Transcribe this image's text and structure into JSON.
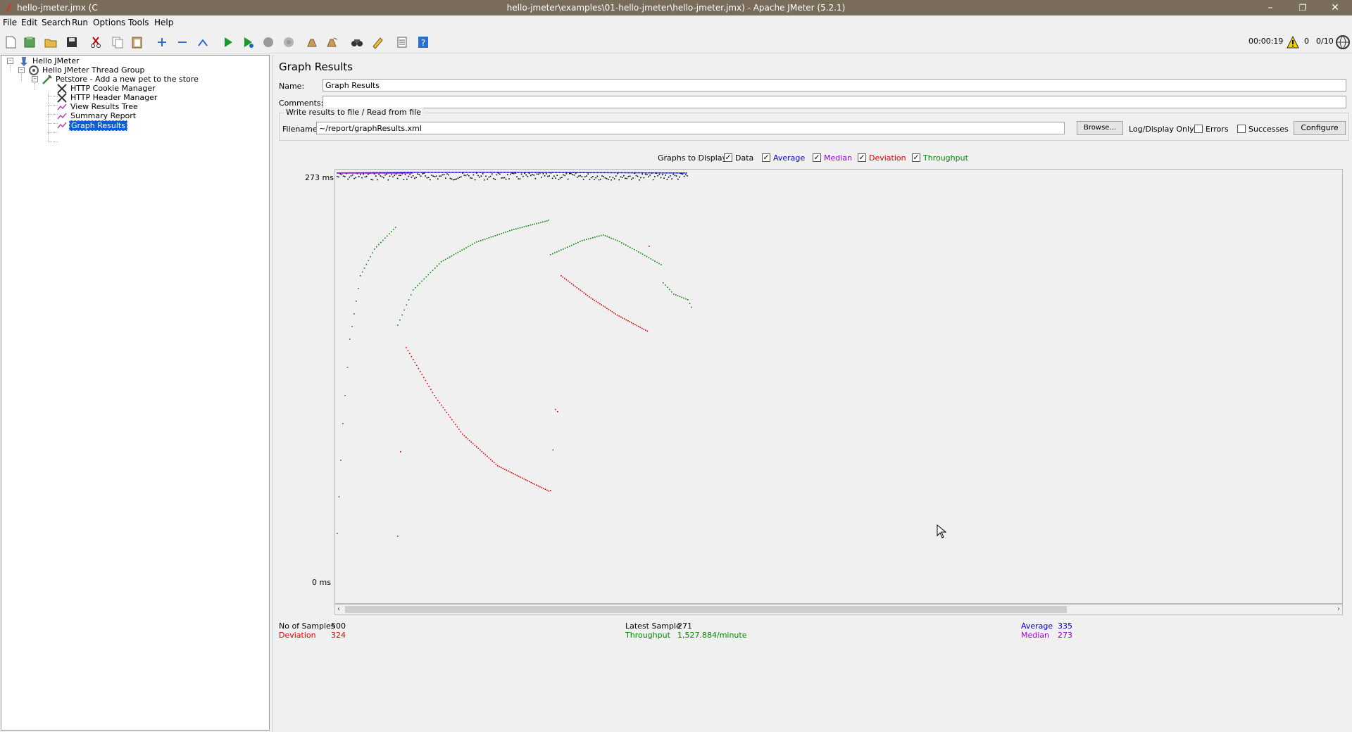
{
  "window": {
    "title_left": "hello-jmeter.jmx (C",
    "title": "hello-jmeter\\examples\\01-hello-jmeter\\hello-jmeter.jmx) - Apache JMeter (5.2.1)",
    "minimize": "–",
    "maximize": "❐",
    "close": "✕"
  },
  "menu": [
    "File",
    "Edit",
    "Search",
    "Run",
    "Options",
    "Tools",
    "Help"
  ],
  "toolbar": {
    "elapsed": "00:00:19",
    "warnings": "0",
    "threads": "0/10"
  },
  "tree": [
    {
      "label": "Hello JMeter",
      "icon": "test-plan-icon"
    },
    {
      "label": "Hello JMeter Thread Group",
      "icon": "thread-group-icon"
    },
    {
      "label": "Petstore - Add a new pet to the store",
      "icon": "http-sampler-icon"
    },
    {
      "label": "HTTP Cookie Manager",
      "icon": "config-element-icon"
    },
    {
      "label": "HTTP Header Manager",
      "icon": "config-element-icon"
    },
    {
      "label": "View Results Tree",
      "icon": "listener-icon"
    },
    {
      "label": "Summary Report",
      "icon": "listener-icon"
    },
    {
      "label": "Graph Results",
      "icon": "listener-icon"
    }
  ],
  "panel": {
    "title": "Graph Results",
    "name_label": "Name:",
    "name_value": "Graph Results",
    "comments_label": "Comments:",
    "comments_value": "",
    "file_section": "Write results to file / Read from file",
    "filename_label": "Filename",
    "filename_value": "~/report/graphResults.xml",
    "browse": "Browse...",
    "log_display": "Log/Display Only:",
    "errors": "Errors",
    "successes": "Successes",
    "configure": "Configure",
    "graphs_to_display": "Graphs to Display",
    "graph_options": [
      {
        "label": "Data",
        "checked": true,
        "color": "#000000"
      },
      {
        "label": "Average",
        "checked": true,
        "color": "#0000cc"
      },
      {
        "label": "Median",
        "checked": true,
        "color": "#9900cc"
      },
      {
        "label": "Deviation",
        "checked": true,
        "color": "#dd0000"
      },
      {
        "label": "Throughput",
        "checked": true,
        "color": "#008800"
      }
    ],
    "y_top": "273  ms",
    "y_bottom": "0  ms",
    "stats": {
      "samples_label": "No of Samples",
      "samples": "500",
      "deviation_label": "Deviation",
      "deviation": "324",
      "latest_label": "Latest Sample",
      "latest": "271",
      "throughput_label": "Throughput",
      "throughput": "1,527.884/minute",
      "average_label": "Average",
      "average": "335",
      "median_label": "Median",
      "median": "273"
    }
  },
  "colors": {
    "data": "#000000",
    "average": "#0000cc",
    "median": "#9900cc",
    "deviation": "#dd0000",
    "throughput": "#008800",
    "selection": "#0a5fd6"
  }
}
